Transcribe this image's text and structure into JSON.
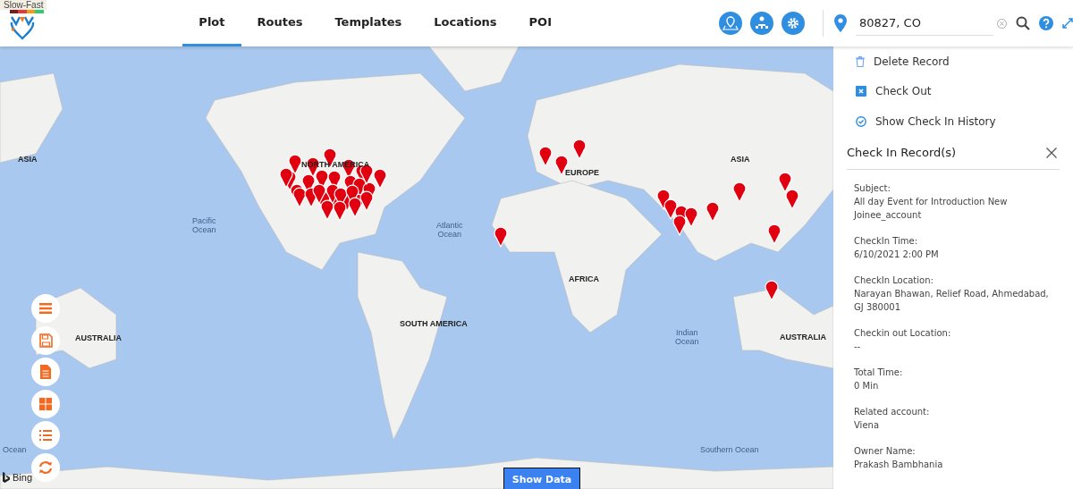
{
  "speed_legend": {
    "label": "Slow-Fast"
  },
  "tabs": [
    {
      "label": "Plot",
      "selected": true
    },
    {
      "label": "Routes",
      "selected": false
    },
    {
      "label": "Templates",
      "selected": false
    },
    {
      "label": "Locations",
      "selected": false
    },
    {
      "label": "POI",
      "selected": false
    }
  ],
  "search": {
    "value": "80827, CO"
  },
  "map": {
    "labels": [
      {
        "text": "ASIA",
        "kind": "land"
      },
      {
        "text": "NORTH AMERICA",
        "kind": "land"
      },
      {
        "text": "EUROPE",
        "kind": "land"
      },
      {
        "text": "Pacific\nOcean",
        "kind": "sea"
      },
      {
        "text": "Atlantic\nOcean",
        "kind": "sea"
      },
      {
        "text": "AFRICA",
        "kind": "land"
      },
      {
        "text": "SOUTH AMERICA",
        "kind": "land"
      },
      {
        "text": "AUSTRALIA",
        "kind": "land"
      },
      {
        "text": "Indian\nOcean",
        "kind": "sea"
      },
      {
        "text": "ASIA",
        "kind": "land"
      },
      {
        "text": "AUSTRALIA",
        "kind": "land"
      },
      {
        "text": "Ocean",
        "kind": "sea"
      },
      {
        "text": "Southern Ocean",
        "kind": "sea"
      }
    ],
    "attribution": "Bing",
    "show_data_button": "Show Data"
  },
  "actions": [
    {
      "label": "Delete Record",
      "kind": "delete"
    },
    {
      "label": "Check Out",
      "kind": "checkout"
    },
    {
      "label": "Show Check In History",
      "kind": "history"
    }
  ],
  "record_panel": {
    "title": "Check In Record(s)",
    "fields": [
      {
        "label": "Subject:",
        "value": "All day Event for Introduction New Joinee_account"
      },
      {
        "label": "CheckIn Time:",
        "value": "6/10/2021 2:00 PM"
      },
      {
        "label": "CheckIn Location:",
        "value": "Narayan Bhawan, Relief Road, Ahmedabad, GJ 380001"
      },
      {
        "label": "Checkin out Location:",
        "value": "--"
      },
      {
        "label": "Total Time:",
        "value": "0 Min"
      },
      {
        "label": "Related account:",
        "value": "Viena"
      },
      {
        "label": "Owner Name:",
        "value": "Prakash Bambhania"
      }
    ]
  }
}
